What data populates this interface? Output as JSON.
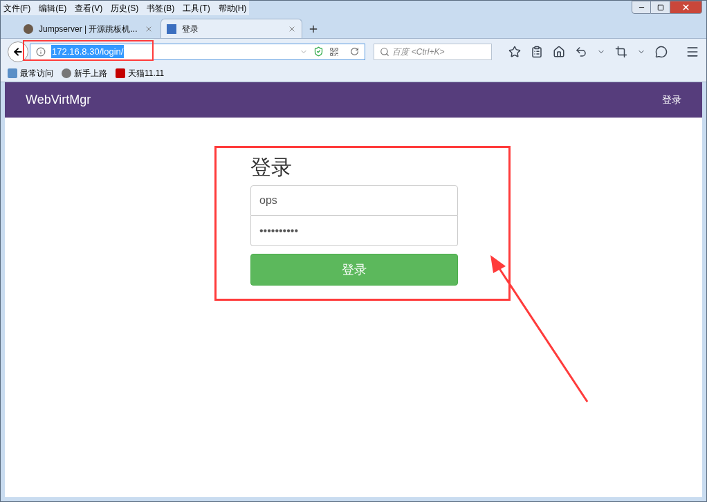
{
  "menu_bar": [
    "文件(F)",
    "编辑(E)",
    "查看(V)",
    "历史(S)",
    "书签(B)",
    "工具(T)",
    "帮助(H)"
  ],
  "tabs": [
    {
      "label": "Jumpserver | 开源跳板机...",
      "selected": false
    },
    {
      "label": "登录",
      "selected": true
    }
  ],
  "address_bar": {
    "value": "172.16.8.30/login/"
  },
  "search": {
    "placeholder": "百度 <Ctrl+K>"
  },
  "bookmarks": [
    "最常访问",
    "新手上路",
    "天猫11.11"
  ],
  "page": {
    "brand": "WebVirtMgr",
    "nav_link": "登录",
    "heading": "登录",
    "username": {
      "value": "ops"
    },
    "password": {
      "value": "••••••••••"
    },
    "submit": "登录"
  }
}
